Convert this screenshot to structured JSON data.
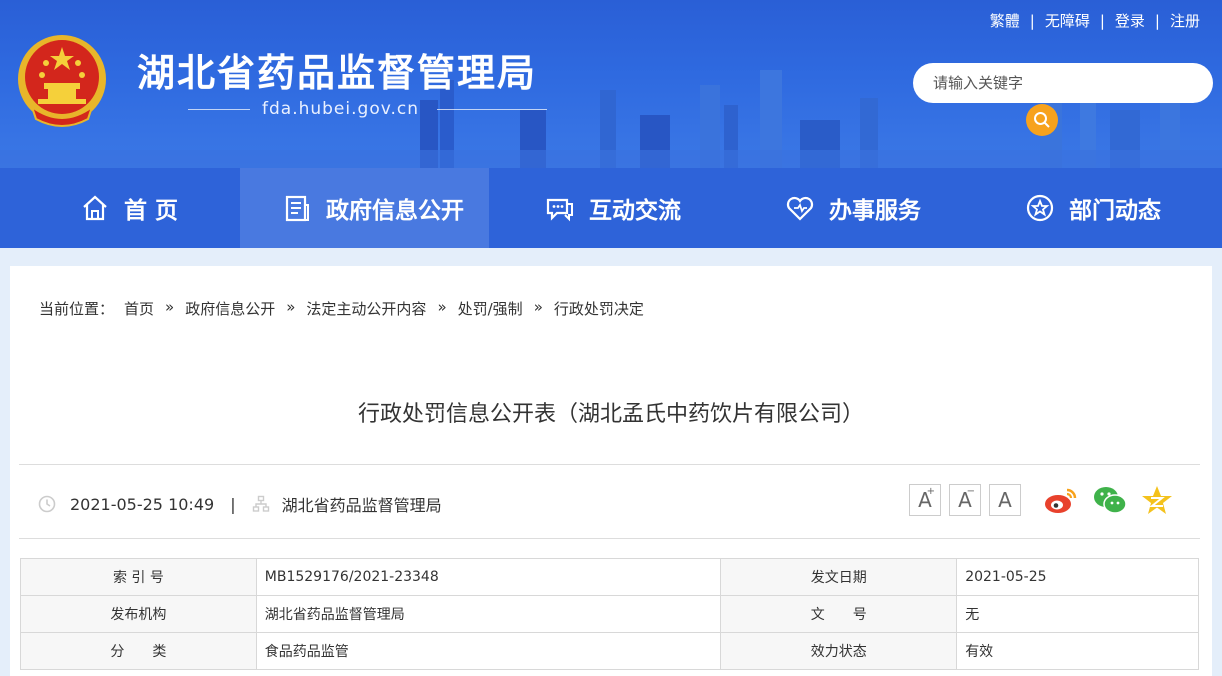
{
  "header": {
    "site_title": "湖北省药品监督管理局",
    "site_url": "fda.hubei.gov.cn",
    "top_links": [
      "繁體",
      "无障碍",
      "登录",
      "注册"
    ],
    "search_placeholder": "请输入关键字"
  },
  "nav": {
    "items": [
      {
        "label": "首 页",
        "icon": "home-icon"
      },
      {
        "label": "政府信息公开",
        "icon": "document-icon"
      },
      {
        "label": "互动交流",
        "icon": "chat-icon"
      },
      {
        "label": "办事服务",
        "icon": "heart-icon"
      },
      {
        "label": "部门动态",
        "icon": "star-circle-icon"
      }
    ],
    "active_index": 1
  },
  "breadcrumb": {
    "prefix": "当前位置：",
    "separator": "»",
    "items": [
      "首页",
      "政府信息公开",
      "法定主动公开内容",
      "处罚/强制",
      "行政处罚决定"
    ]
  },
  "article": {
    "title": "行政处罚信息公开表（湖北孟氏中药饮片有限公司）",
    "datetime": "2021-05-25 10:49",
    "publisher": "湖北省药品监督管理局",
    "separator": "|",
    "font_sizes": [
      "A",
      "A",
      "A"
    ],
    "share_icons": [
      "weibo-icon",
      "wechat-icon",
      "qzone-icon"
    ]
  },
  "info_table": {
    "rows": [
      {
        "k1": "索 引 号",
        "v1": "MB1529176/2021-23348",
        "k2": "发文日期",
        "v2": "2021-05-25"
      },
      {
        "k1": "发布机构",
        "v1": "湖北省药品监督管理局",
        "k2": "文　　号",
        "v2": "无"
      },
      {
        "k1": "分　　类",
        "v1": "食品药品监管",
        "k2": "效力状态",
        "v2": "有效"
      }
    ]
  },
  "colors": {
    "header_blue": "#2e63d9",
    "nav_active": "#4979e0",
    "search_button": "#f7a21c"
  }
}
